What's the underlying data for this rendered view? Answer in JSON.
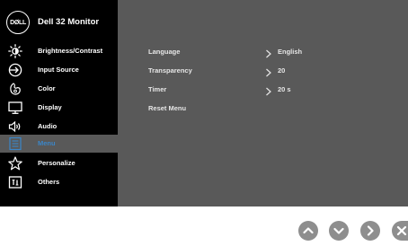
{
  "header": {
    "logo_text": "DØLL",
    "title": "Dell 32 Monitor"
  },
  "sidebar": {
    "items": [
      {
        "label": "Brightness/Contrast",
        "icon": "sun-icon"
      },
      {
        "label": "Input Source",
        "icon": "input-arrow-icon"
      },
      {
        "label": "Color",
        "icon": "color-palette-icon"
      },
      {
        "label": "Display",
        "icon": "display-monitor-icon"
      },
      {
        "label": "Audio",
        "icon": "speaker-icon"
      },
      {
        "label": "Menu",
        "icon": "menu-list-icon",
        "active": true
      },
      {
        "label": "Personalize",
        "icon": "star-icon"
      },
      {
        "label": "Others",
        "icon": "info-box-icon"
      }
    ]
  },
  "main": {
    "rows": [
      {
        "label": "Language",
        "value": "English"
      },
      {
        "label": "Transparency",
        "value": "20"
      },
      {
        "label": "Timer",
        "value": "20 s"
      },
      {
        "label": "Reset Menu",
        "value": ""
      }
    ]
  },
  "buttons": [
    {
      "icon": "chevron-up-icon"
    },
    {
      "icon": "chevron-down-icon"
    },
    {
      "icon": "chevron-right-icon"
    },
    {
      "icon": "close-icon"
    }
  ],
  "colors": {
    "sidebar_bg": "#000000",
    "main_bg": "#595959",
    "active_label": "#3b86c8",
    "button_bg": "#8e8e8e"
  }
}
